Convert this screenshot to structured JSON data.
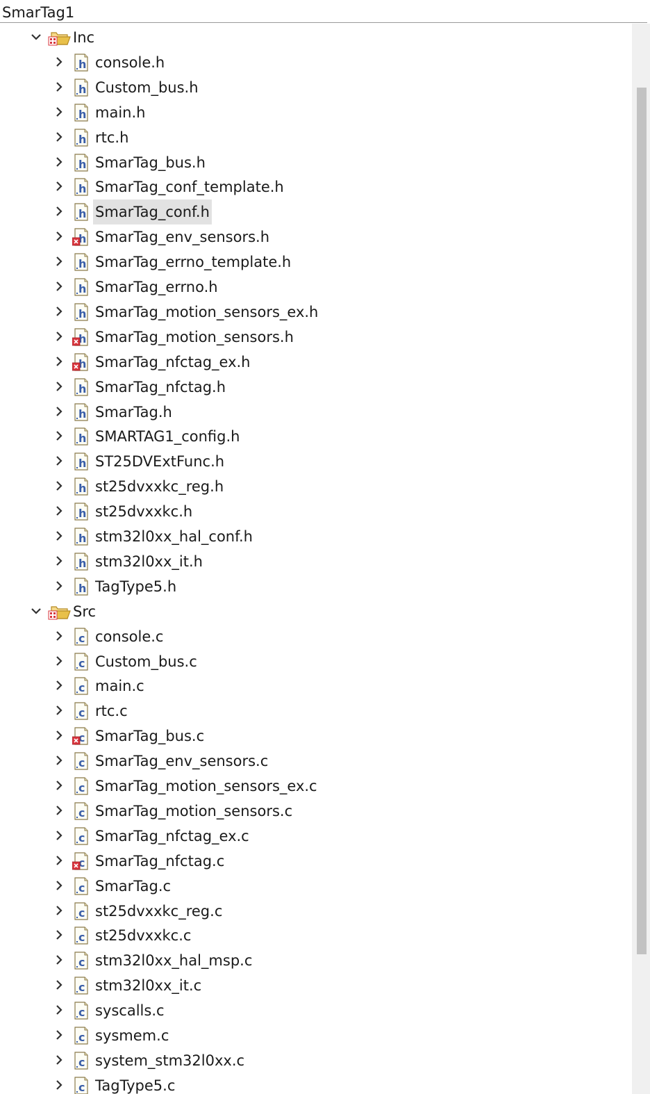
{
  "project": {
    "title": "SmarTag1"
  },
  "colors": {
    "folder": "#e8c04a",
    "header_letter": "#3a5ea8",
    "source_letter": "#3a5ea8",
    "error": "#d9363e",
    "selection": "#e2e2e2"
  },
  "icons": {
    "expanded": "chevron-down-icon",
    "collapsed": "chevron-right-icon",
    "folder": "source-folder-icon",
    "header": "c-header-file-icon",
    "source": "c-source-file-icon",
    "error_overlay": "error-overlay-icon"
  },
  "scrollbar": {
    "position_fraction": 0.06,
    "visible_fraction": 0.81
  },
  "tree": [
    {
      "label": "Inc",
      "expanded": true,
      "children": [
        {
          "label": "console.h",
          "type": "h",
          "error": false
        },
        {
          "label": "Custom_bus.h",
          "type": "h",
          "error": false
        },
        {
          "label": "main.h",
          "type": "h",
          "error": false
        },
        {
          "label": "rtc.h",
          "type": "h",
          "error": false
        },
        {
          "label": "SmarTag_bus.h",
          "type": "h",
          "error": false
        },
        {
          "label": "SmarTag_conf_template.h",
          "type": "h",
          "error": false
        },
        {
          "label": "SmarTag_conf.h",
          "type": "h",
          "error": false,
          "selected": true
        },
        {
          "label": "SmarTag_env_sensors.h",
          "type": "h",
          "error": true
        },
        {
          "label": "SmarTag_errno_template.h",
          "type": "h",
          "error": false
        },
        {
          "label": "SmarTag_errno.h",
          "type": "h",
          "error": false
        },
        {
          "label": "SmarTag_motion_sensors_ex.h",
          "type": "h",
          "error": false
        },
        {
          "label": "SmarTag_motion_sensors.h",
          "type": "h",
          "error": true
        },
        {
          "label": "SmarTag_nfctag_ex.h",
          "type": "h",
          "error": true
        },
        {
          "label": "SmarTag_nfctag.h",
          "type": "h",
          "error": false
        },
        {
          "label": "SmarTag.h",
          "type": "h",
          "error": false
        },
        {
          "label": "SMARTAG1_config.h",
          "type": "h",
          "error": false
        },
        {
          "label": "ST25DVExtFunc.h",
          "type": "h",
          "error": false
        },
        {
          "label": "st25dvxxkc_reg.h",
          "type": "h",
          "error": false
        },
        {
          "label": "st25dvxxkc.h",
          "type": "h",
          "error": false
        },
        {
          "label": "stm32l0xx_hal_conf.h",
          "type": "h",
          "error": false
        },
        {
          "label": "stm32l0xx_it.h",
          "type": "h",
          "error": false
        },
        {
          "label": "TagType5.h",
          "type": "h",
          "error": false
        }
      ]
    },
    {
      "label": "Src",
      "expanded": true,
      "children": [
        {
          "label": "console.c",
          "type": "c",
          "error": false
        },
        {
          "label": "Custom_bus.c",
          "type": "c",
          "error": false
        },
        {
          "label": "main.c",
          "type": "c",
          "error": false
        },
        {
          "label": "rtc.c",
          "type": "c",
          "error": false
        },
        {
          "label": "SmarTag_bus.c",
          "type": "c",
          "error": true
        },
        {
          "label": "SmarTag_env_sensors.c",
          "type": "c",
          "error": false
        },
        {
          "label": "SmarTag_motion_sensors_ex.c",
          "type": "c",
          "error": false
        },
        {
          "label": "SmarTag_motion_sensors.c",
          "type": "c",
          "error": false
        },
        {
          "label": "SmarTag_nfctag_ex.c",
          "type": "c",
          "error": false
        },
        {
          "label": "SmarTag_nfctag.c",
          "type": "c",
          "error": true
        },
        {
          "label": "SmarTag.c",
          "type": "c",
          "error": false
        },
        {
          "label": "st25dvxxkc_reg.c",
          "type": "c",
          "error": false
        },
        {
          "label": "st25dvxxkc.c",
          "type": "c",
          "error": false
        },
        {
          "label": "stm32l0xx_hal_msp.c",
          "type": "c",
          "error": false
        },
        {
          "label": "stm32l0xx_it.c",
          "type": "c",
          "error": false
        },
        {
          "label": "syscalls.c",
          "type": "c",
          "error": false
        },
        {
          "label": "sysmem.c",
          "type": "c",
          "error": false
        },
        {
          "label": "system_stm32l0xx.c",
          "type": "c",
          "error": false
        },
        {
          "label": "TagType5.c",
          "type": "c",
          "error": false
        }
      ]
    }
  ]
}
